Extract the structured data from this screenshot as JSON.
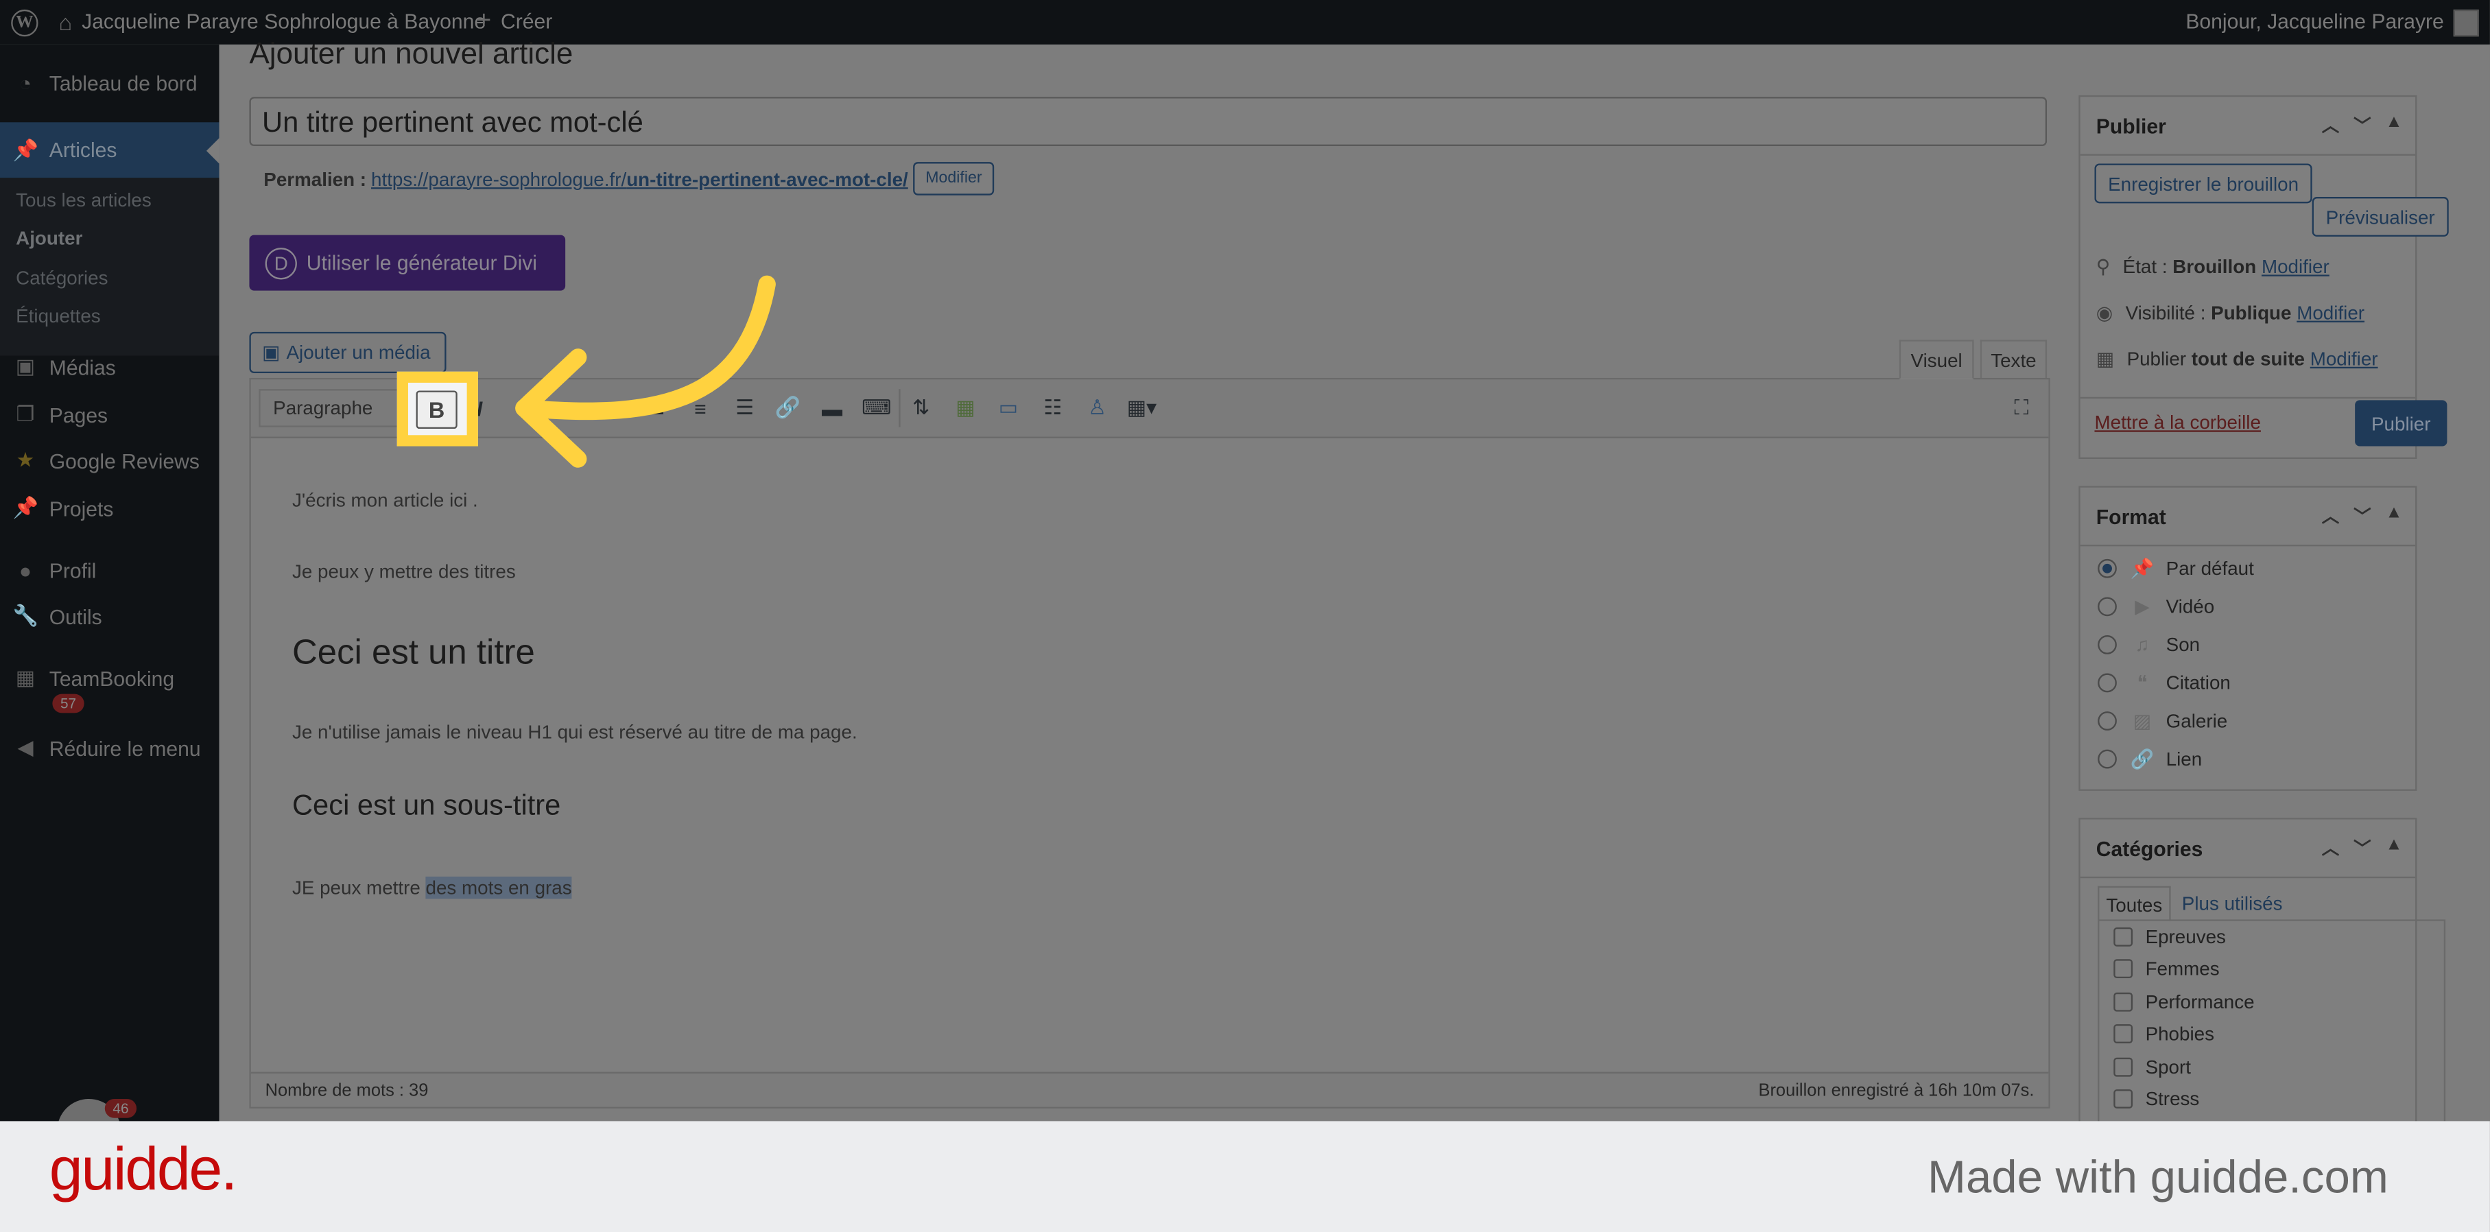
{
  "adminbar": {
    "site_name": "Jacqueline Parayre Sophrologue à Bayonne",
    "create_label": "Créer",
    "greeting": "Bonjour, Jacqueline Parayre"
  },
  "sidebar": {
    "items": [
      {
        "label": "Tableau de bord",
        "icon": "dashboard-icon"
      },
      {
        "label": "Articles",
        "icon": "pin-icon",
        "active": true
      },
      {
        "label": "Médias",
        "icon": "media-icon"
      },
      {
        "label": "Pages",
        "icon": "pages-icon"
      },
      {
        "label": "Google Reviews",
        "icon": "star-icon"
      },
      {
        "label": "Projets",
        "icon": "pin-icon"
      },
      {
        "label": "Profil",
        "icon": "user-icon"
      },
      {
        "label": "Outils",
        "icon": "wrench-icon"
      },
      {
        "label": "TeamBooking",
        "icon": "calendar-icon",
        "badge": "57"
      },
      {
        "label": "Réduire le menu",
        "icon": "collapse-icon"
      }
    ],
    "submenu": [
      "Tous les articles",
      "Ajouter",
      "Catégories",
      "Étiquettes"
    ],
    "floating_badge": "46"
  },
  "main": {
    "page_title": "Ajouter un nouvel article",
    "post_title": "Un titre pertinent avec mot-clé",
    "permalink_label": "Permalien :",
    "permalink_base": "https://parayre-sophrologue.fr/",
    "permalink_slug": "un-titre-pertinent-avec-mot-cle/",
    "permalink_edit": "Modifier",
    "divi_button": "Utiliser le générateur Divi",
    "media_button": "Ajouter un média",
    "tabs": [
      "Visuel",
      "Texte"
    ],
    "format_select": "Paragraphe",
    "bold_label": "B",
    "content": {
      "p1": "J'écris mon article ici .",
      "p2": "Je peux y mettre des titres",
      "h2": "Ceci est un titre",
      "p3": "Je n'utilise jamais le niveau H1 qui est réservé au titre de ma page.",
      "h3": "Ceci est un sous-titre",
      "p4_plain": "JE peux mettre ",
      "p4_selected": "des mots en gras"
    },
    "word_count": "Nombre de mots : 39",
    "autosave": "Brouillon enregistré à 16h 10m 07s."
  },
  "publish": {
    "title": "Publier",
    "save_draft": "Enregistrer le brouillon",
    "preview": "Prévisualiser",
    "status_label": "État :",
    "status_value": "Brouillon",
    "visibility_label": "Visibilité :",
    "visibility_value": "Publique",
    "schedule_label": "Publier",
    "schedule_value": "tout de suite",
    "edit": "Modifier",
    "trash": "Mettre à la corbeille",
    "publish_button": "Publier"
  },
  "format": {
    "title": "Format",
    "options": [
      {
        "label": "Par défaut",
        "icon": "pin-icon",
        "checked": true
      },
      {
        "label": "Vidéo",
        "icon": "video-icon"
      },
      {
        "label": "Son",
        "icon": "music-icon"
      },
      {
        "label": "Citation",
        "icon": "quote-icon"
      },
      {
        "label": "Galerie",
        "icon": "gallery-icon"
      },
      {
        "label": "Lien",
        "icon": "link-icon"
      }
    ]
  },
  "categories": {
    "title": "Catégories",
    "tabs": [
      "Toutes",
      "Plus utilisés"
    ],
    "items": [
      "Epreuves",
      "Femmes",
      "Performance",
      "Phobies",
      "Sport",
      "Stress"
    ]
  },
  "footer": {
    "logo": "guidde.",
    "tagline": "Made with guidde.com"
  },
  "colors": {
    "highlight": "#ffd23f",
    "wp_blue": "#2271b1",
    "divi_purple": "#7e3bd0",
    "guidde_red": "#c50a0a"
  }
}
